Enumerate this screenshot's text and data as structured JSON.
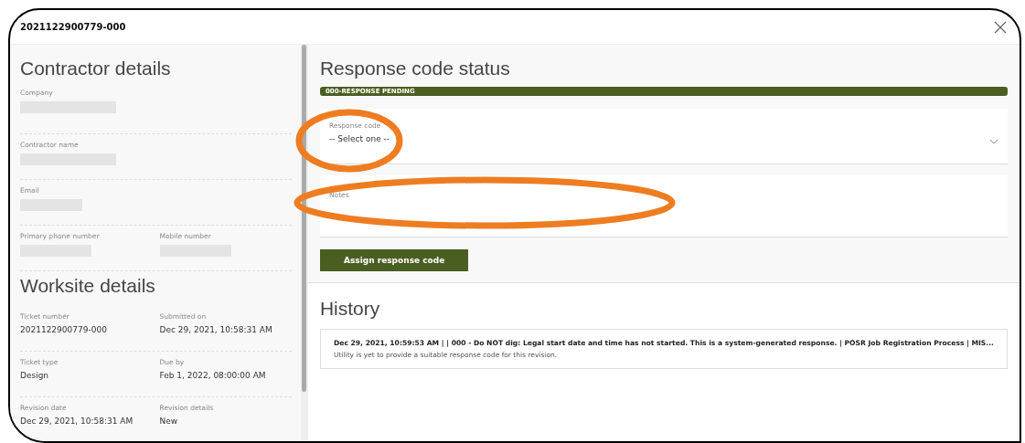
{
  "window": {
    "title": "2021122900779-000"
  },
  "contractor": {
    "heading": "Contractor details",
    "rows": [
      [
        {
          "label": "Company",
          "kind": "redacted"
        }
      ],
      [
        {
          "label": "Contractor name",
          "kind": "redacted"
        }
      ],
      [
        {
          "label": "Email",
          "kind": "redacted"
        }
      ],
      [
        {
          "label": "Primary phone number",
          "kind": "redacted"
        },
        {
          "label": "Mobile number",
          "kind": "redacted"
        }
      ]
    ]
  },
  "worksite": {
    "heading": "Worksite details",
    "rows": [
      [
        {
          "label": "Ticket number",
          "kind": "text",
          "value": "2021122900779-000"
        },
        {
          "label": "Submitted on",
          "kind": "text",
          "value": "Dec 29, 2021, 10:58:31 AM"
        }
      ],
      [
        {
          "label": "Ticket type",
          "kind": "text",
          "value": "Design"
        },
        {
          "label": "Due by",
          "kind": "text",
          "value": "Feb 1, 2022, 08:00:00 AM"
        }
      ],
      [
        {
          "label": "Revision date",
          "kind": "text",
          "value": "Dec 29, 2021, 10:58:31 AM"
        },
        {
          "label": "Revision details",
          "kind": "text",
          "value": "New"
        }
      ]
    ]
  },
  "response": {
    "heading": "Response code status",
    "status": "000-RESPONSE PENDING",
    "code_field": {
      "label": "Response code",
      "value": "-- Select one --"
    },
    "notes_field": {
      "label": "Notes"
    },
    "button": "Assign response code"
  },
  "history": {
    "heading": "History",
    "entries": [
      {
        "title": "Dec 29, 2021, 10:59:53 AM | | 000 - Do NOT dig: Legal start date and time has not started. This is a system-generated response. | POSR Job Registration Process | MIS...",
        "detail": "Utility is yet to provide a suitable response code for this revision."
      }
    ]
  }
}
